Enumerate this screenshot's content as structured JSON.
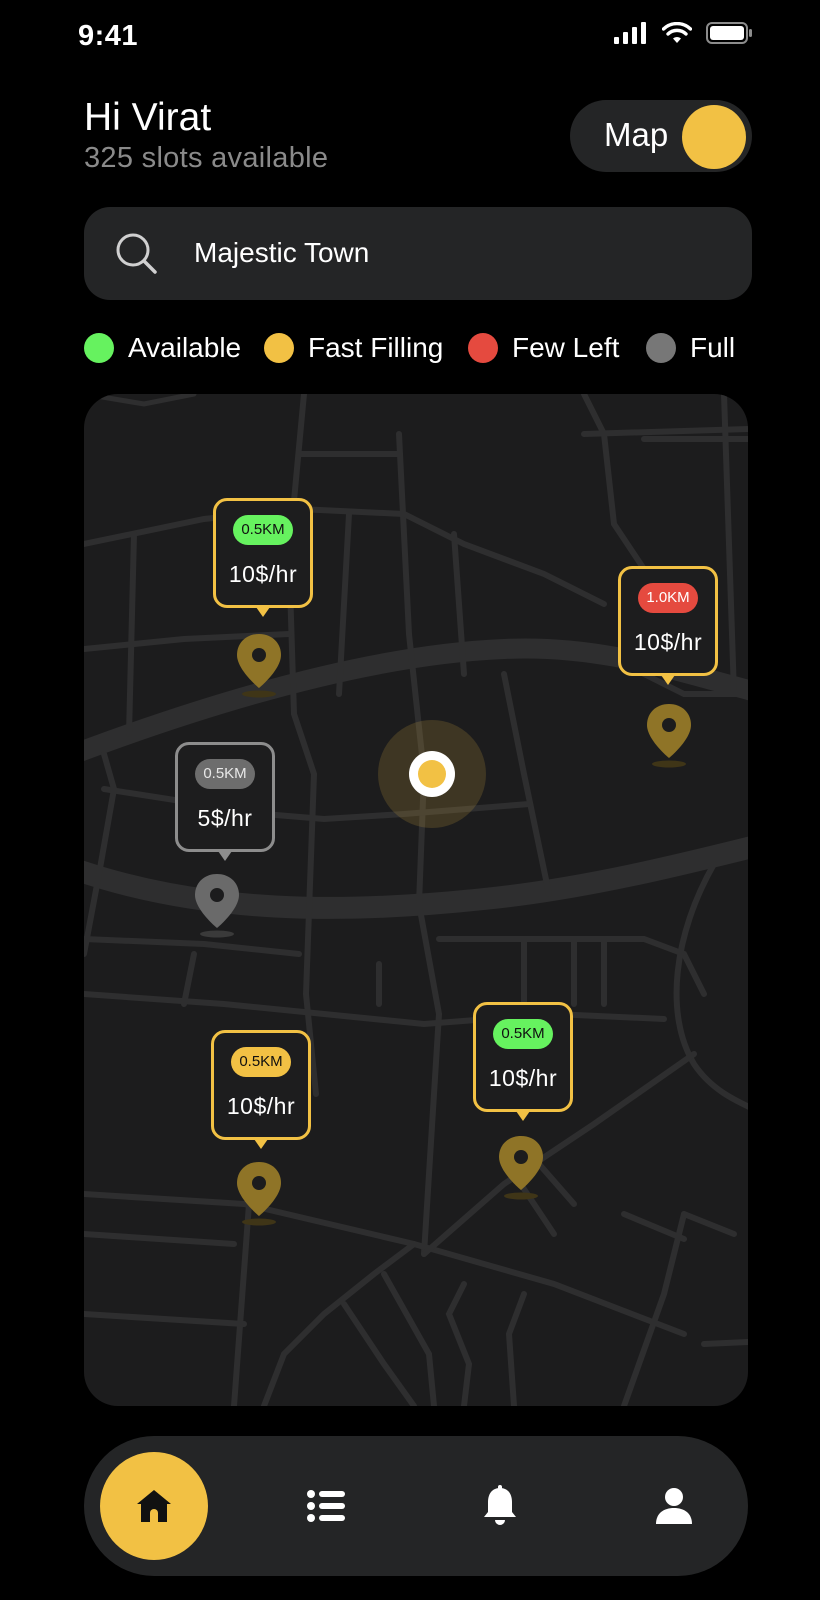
{
  "status_bar": {
    "time": "9:41",
    "icons": [
      "signal-icon",
      "wifi-icon",
      "battery-icon"
    ]
  },
  "header": {
    "greeting": "Hi Virat",
    "subtitle": "325 slots available"
  },
  "map_toggle": {
    "label": "Map",
    "state": "on"
  },
  "search": {
    "value": "Majestic Town",
    "icon": "search-icon"
  },
  "legend": [
    {
      "label": "Available",
      "color": "#66f25f"
    },
    {
      "label": "Fast Filling",
      "color": "#f2c144"
    },
    {
      "label": "Few Left",
      "color": "#e54a3f"
    },
    {
      "label": "Full",
      "color": "#777777"
    }
  ],
  "parking_spots": [
    {
      "distance": "0.5KM",
      "price": "10$/hr",
      "status": "Available"
    },
    {
      "distance": "1.0KM",
      "price": "10$/hr",
      "status": "Few Left"
    },
    {
      "distance": "0.5KM",
      "price": "5$/hr",
      "status": "Full"
    },
    {
      "distance": "0.5KM",
      "price": "10$/hr",
      "status": "Fast Filling"
    },
    {
      "distance": "0.5KM",
      "price": "10$/hr",
      "status": "Available"
    }
  ],
  "nav": {
    "items": [
      {
        "icon": "home-icon",
        "active": true
      },
      {
        "icon": "list-icon",
        "active": false
      },
      {
        "icon": "bell-icon",
        "active": false
      },
      {
        "icon": "profile-icon",
        "active": false
      }
    ]
  },
  "colors": {
    "accent": "#f2c144",
    "surface": "#242526",
    "map_bg": "#1c1c1d",
    "road": "#2e2e2f"
  }
}
